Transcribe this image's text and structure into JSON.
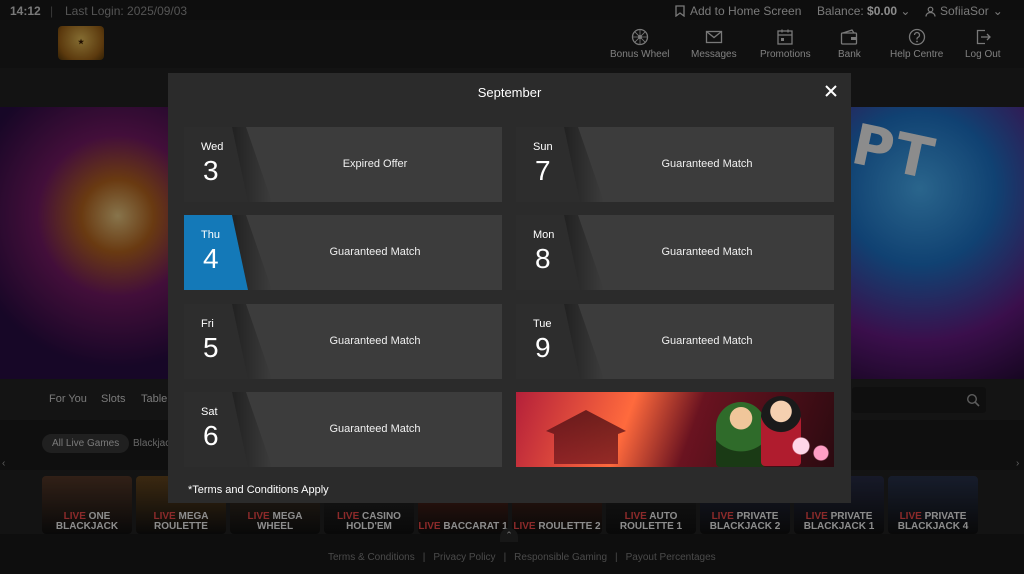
{
  "topbar": {
    "time": "14:12",
    "separator": "|",
    "last_login": "Last Login: 2025/09/03",
    "add_home": "Add to Home Screen",
    "balance_label": "Balance:",
    "balance_value": "$0.00",
    "username": "SofiiaSor"
  },
  "nav": [
    {
      "label": "Bonus Wheel",
      "icon": "bonus-wheel-icon"
    },
    {
      "label": "Messages",
      "icon": "envelope-icon"
    },
    {
      "label": "Promotions",
      "icon": "calendar-icon"
    },
    {
      "label": "Bank",
      "icon": "wallet-icon"
    },
    {
      "label": "Help Centre",
      "icon": "question-icon"
    },
    {
      "label": "Log Out",
      "icon": "logout-icon"
    }
  ],
  "categories": [
    "For You",
    "Slots",
    "Table"
  ],
  "filters": {
    "active": "All Live Games",
    "next": "Blackjac"
  },
  "games": [
    {
      "prefix": "LIVE",
      "name": "ONE BLACKJACK",
      "color": "#5a3b2a"
    },
    {
      "prefix": "LIVE",
      "name": "MEGA ROULETTE",
      "color": "#6b4a20"
    },
    {
      "prefix": "LIVE",
      "name": "MEGA WHEEL",
      "color": "#4a3a2a"
    },
    {
      "prefix": "LIVE",
      "name": "CASINO HOLD'EM",
      "color": "#2e2e2e"
    },
    {
      "prefix": "LIVE",
      "name": "BACCARAT 1",
      "color": "#6b2a1a"
    },
    {
      "prefix": "LIVE",
      "name": "ROULETTE 2",
      "color": "#5a2a1a"
    },
    {
      "prefix": "LIVE",
      "name": "AUTO ROULETTE 1",
      "color": "#2a2a2a"
    },
    {
      "prefix": "LIVE",
      "name": "PRIVATE BLACKJACK 2",
      "color": "#2a2f4a"
    },
    {
      "prefix": "LIVE",
      "name": "PRIVATE BLACKJACK 1",
      "color": "#2a2f4a"
    },
    {
      "prefix": "LIVE",
      "name": "PRIVATE BLACKJACK 4",
      "color": "#2a3550"
    }
  ],
  "footer": {
    "links": [
      "Terms & Conditions",
      "|",
      "Privacy Policy",
      "|",
      "Responsible Gaming",
      "|",
      "Payout Percentages"
    ]
  },
  "modal": {
    "title": "September",
    "cards": [
      {
        "dow": "Wed",
        "day": "3",
        "label": "Expired Offer",
        "active": false
      },
      {
        "dow": "Sun",
        "day": "7",
        "label": "Guaranteed Match",
        "active": false
      },
      {
        "dow": "Thu",
        "day": "4",
        "label": "Guaranteed Match",
        "active": true
      },
      {
        "dow": "Mon",
        "day": "8",
        "label": "Guaranteed Match",
        "active": false
      },
      {
        "dow": "Fri",
        "day": "5",
        "label": "Guaranteed Match",
        "active": false
      },
      {
        "dow": "Tue",
        "day": "9",
        "label": "Guaranteed Match",
        "active": false
      },
      {
        "dow": "Sat",
        "day": "6",
        "label": "Guaranteed Match",
        "active": false
      }
    ],
    "terms": "*Terms and Conditions Apply"
  },
  "colors": {
    "accent": "#1479b8",
    "modal_bg": "#2b2b2b",
    "card_bg": "#3c3c3c",
    "live_red": "#ff4d4d"
  }
}
